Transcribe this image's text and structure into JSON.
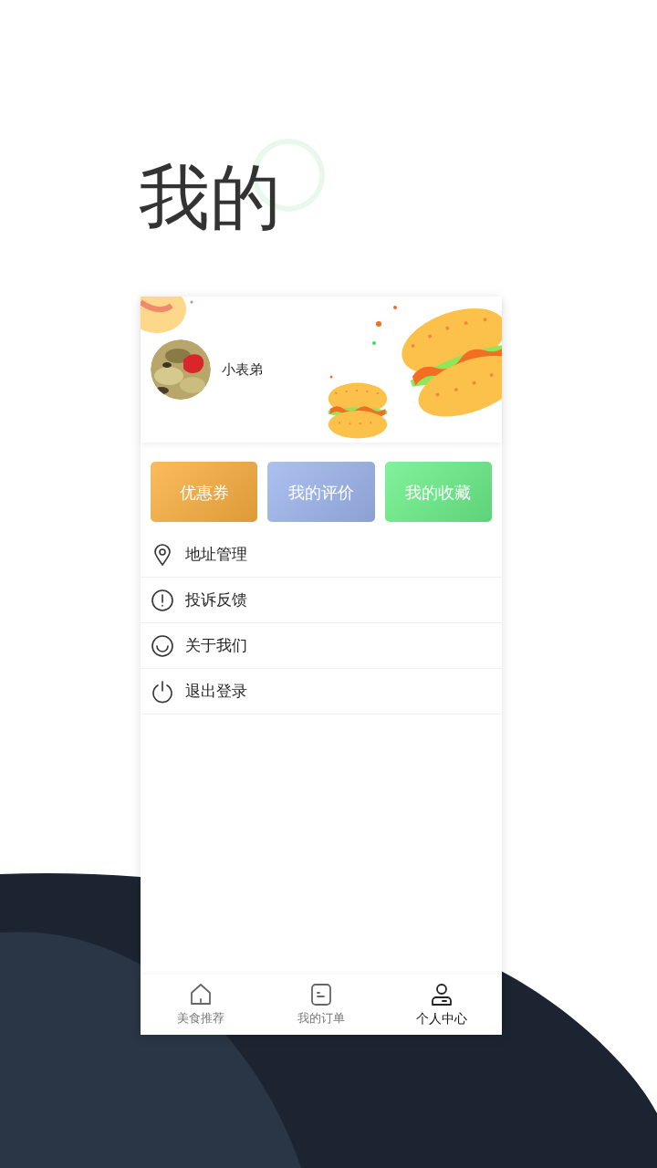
{
  "heading": "我的",
  "profile": {
    "name": "小表弟"
  },
  "shortcuts": [
    {
      "label": "优惠券",
      "color": "#fbb040"
    },
    {
      "label": "我的评价",
      "color": "#9fb6ee"
    },
    {
      "label": "我的收藏",
      "color": "#6cf08a"
    }
  ],
  "menu": [
    {
      "kind": "location",
      "label": "地址管理"
    },
    {
      "kind": "alert",
      "label": "投诉反馈"
    },
    {
      "kind": "smile",
      "label": "关于我们"
    },
    {
      "kind": "power",
      "label": "退出登录"
    }
  ],
  "tabs": [
    {
      "kind": "home",
      "label": "美食推荐",
      "selected": false
    },
    {
      "kind": "order",
      "label": "我的订单",
      "selected": false
    },
    {
      "kind": "user",
      "label": "个人中心",
      "selected": true
    }
  ]
}
